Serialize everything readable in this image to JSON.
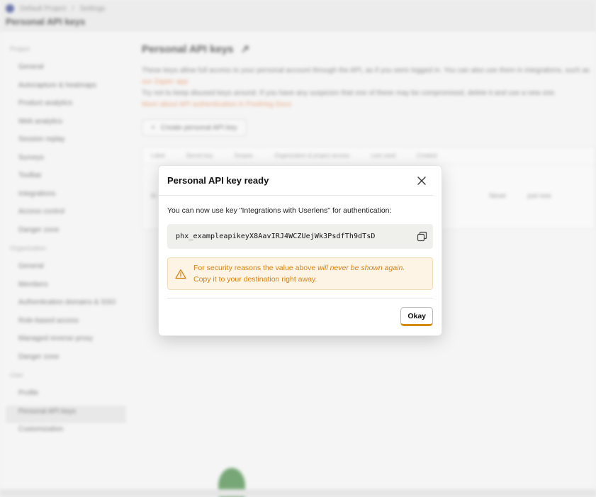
{
  "background": {
    "breadcrumb": [
      "Default Project",
      "Settings"
    ],
    "page_heading": "Personal API keys",
    "sidebar": {
      "sections": [
        {
          "label": "Project",
          "items": [
            "General",
            "Autocapture & heatmaps",
            "Product analytics",
            "Web analytics",
            "Session replay",
            "Surveys",
            "Toolbar",
            "Integrations",
            "Access control",
            "Danger zone"
          ]
        },
        {
          "label": "Organization",
          "items": [
            "General",
            "Members",
            "Authentication domains & SSO",
            "Role-based access",
            "Managed reverse proxy",
            "Danger zone"
          ]
        },
        {
          "label": "User",
          "items": [
            "Profile",
            "Personal API keys",
            "Customization"
          ]
        }
      ],
      "active_item": "Personal API keys"
    },
    "content": {
      "title": "Personal API keys",
      "description_1": "These keys allow full access to your personal account through the API, as if you were logged in. You can also use them in integrations, such as",
      "description_link_1": "our Zapier app",
      "description_2": "Try not to keep disused keys around. If you have any suspicion that one of these may be compromised, delete it and use a new one.",
      "description_link_2": "More about API authentication in PostHog Docs",
      "create_button": "Create personal API key",
      "table_headers": [
        "Label",
        "Secret key",
        "Scopes",
        "Organization & project access",
        "Last used",
        "Created"
      ],
      "table_row": [
        "In",
        "Never",
        "just now"
      ]
    }
  },
  "modal": {
    "title": "Personal API key ready",
    "message": "You can now use key \"Integrations with Userlens\" for authentication:",
    "api_key": "phx_exampleapikeyX8AavIRJ4WCZUejWk3PsdfTh9dTsD",
    "warning_part1": "For security reasons the value above ",
    "warning_emphasis": "will never be shown again.",
    "warning_part2": "Copy it to your destination right away.",
    "ok_label": "Okay",
    "icons": {
      "close": "close-icon",
      "copy": "copy-icon",
      "warning": "warning-icon"
    }
  },
  "colors": {
    "warning_text": "#d9830f",
    "warning_bg": "#fdf4e6",
    "ok_accent": "#d48a10"
  }
}
